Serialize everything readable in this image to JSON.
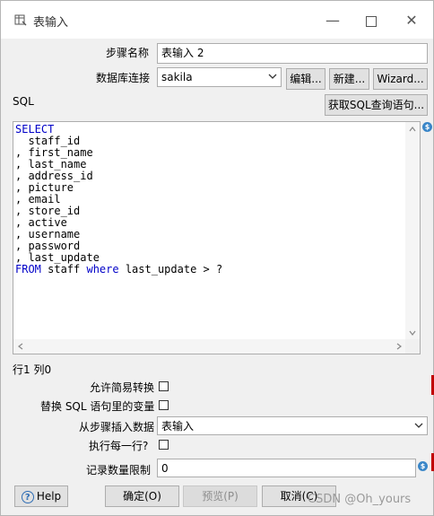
{
  "window": {
    "title": "表输入",
    "minimize": "—",
    "close": "✕"
  },
  "form": {
    "step_name_label": "步骤名称",
    "step_name_value": "表输入 2",
    "db_connection_label": "数据库连接",
    "db_connection_value": "sakila",
    "edit_button": "编辑...",
    "new_button": "新建...",
    "wizard_button": "Wizard...",
    "sql_label": "SQL",
    "get_sql_button": "获取SQL查询语句..."
  },
  "sql": {
    "lines": [
      {
        "kw": "SELECT",
        "text": ""
      },
      {
        "kw": "",
        "text": "  staff_id"
      },
      {
        "kw": "",
        "text": ", first_name"
      },
      {
        "kw": "",
        "text": ", last_name"
      },
      {
        "kw": "",
        "text": ", address_id"
      },
      {
        "kw": "",
        "text": ", picture"
      },
      {
        "kw": "",
        "text": ", email"
      },
      {
        "kw": "",
        "text": ", store_id"
      },
      {
        "kw": "",
        "text": ", active"
      },
      {
        "kw": "",
        "text": ", username"
      },
      {
        "kw": "",
        "text": ", password"
      },
      {
        "kw": "",
        "text": ", last_update"
      }
    ],
    "last_line": {
      "kw1": "FROM",
      "t1": " staff ",
      "kw2": "where",
      "t2": " last_update > ?"
    }
  },
  "status": {
    "position": "行1 列0"
  },
  "options": {
    "lazy_conversion_label": "允许简易转换",
    "lazy_conversion_checked": false,
    "replace_vars_label": "替换 SQL 语句里的变量",
    "replace_vars_checked": false,
    "insert_from_step_label": "从步骤插入数据",
    "insert_from_step_value": "表输入",
    "execute_each_row_label": "执行每一行?",
    "execute_each_row_checked": false,
    "limit_label": "记录数量限制",
    "limit_value": "0"
  },
  "footer": {
    "help_button": "Help",
    "ok_button": "确定(O)",
    "preview_button": "预览(P)",
    "cancel_button": "取消(C)"
  },
  "watermark": "CSDN @Oh_yours",
  "colors": {
    "sql_keyword": "#0000c8",
    "variable_badge": "#3a86c8"
  }
}
